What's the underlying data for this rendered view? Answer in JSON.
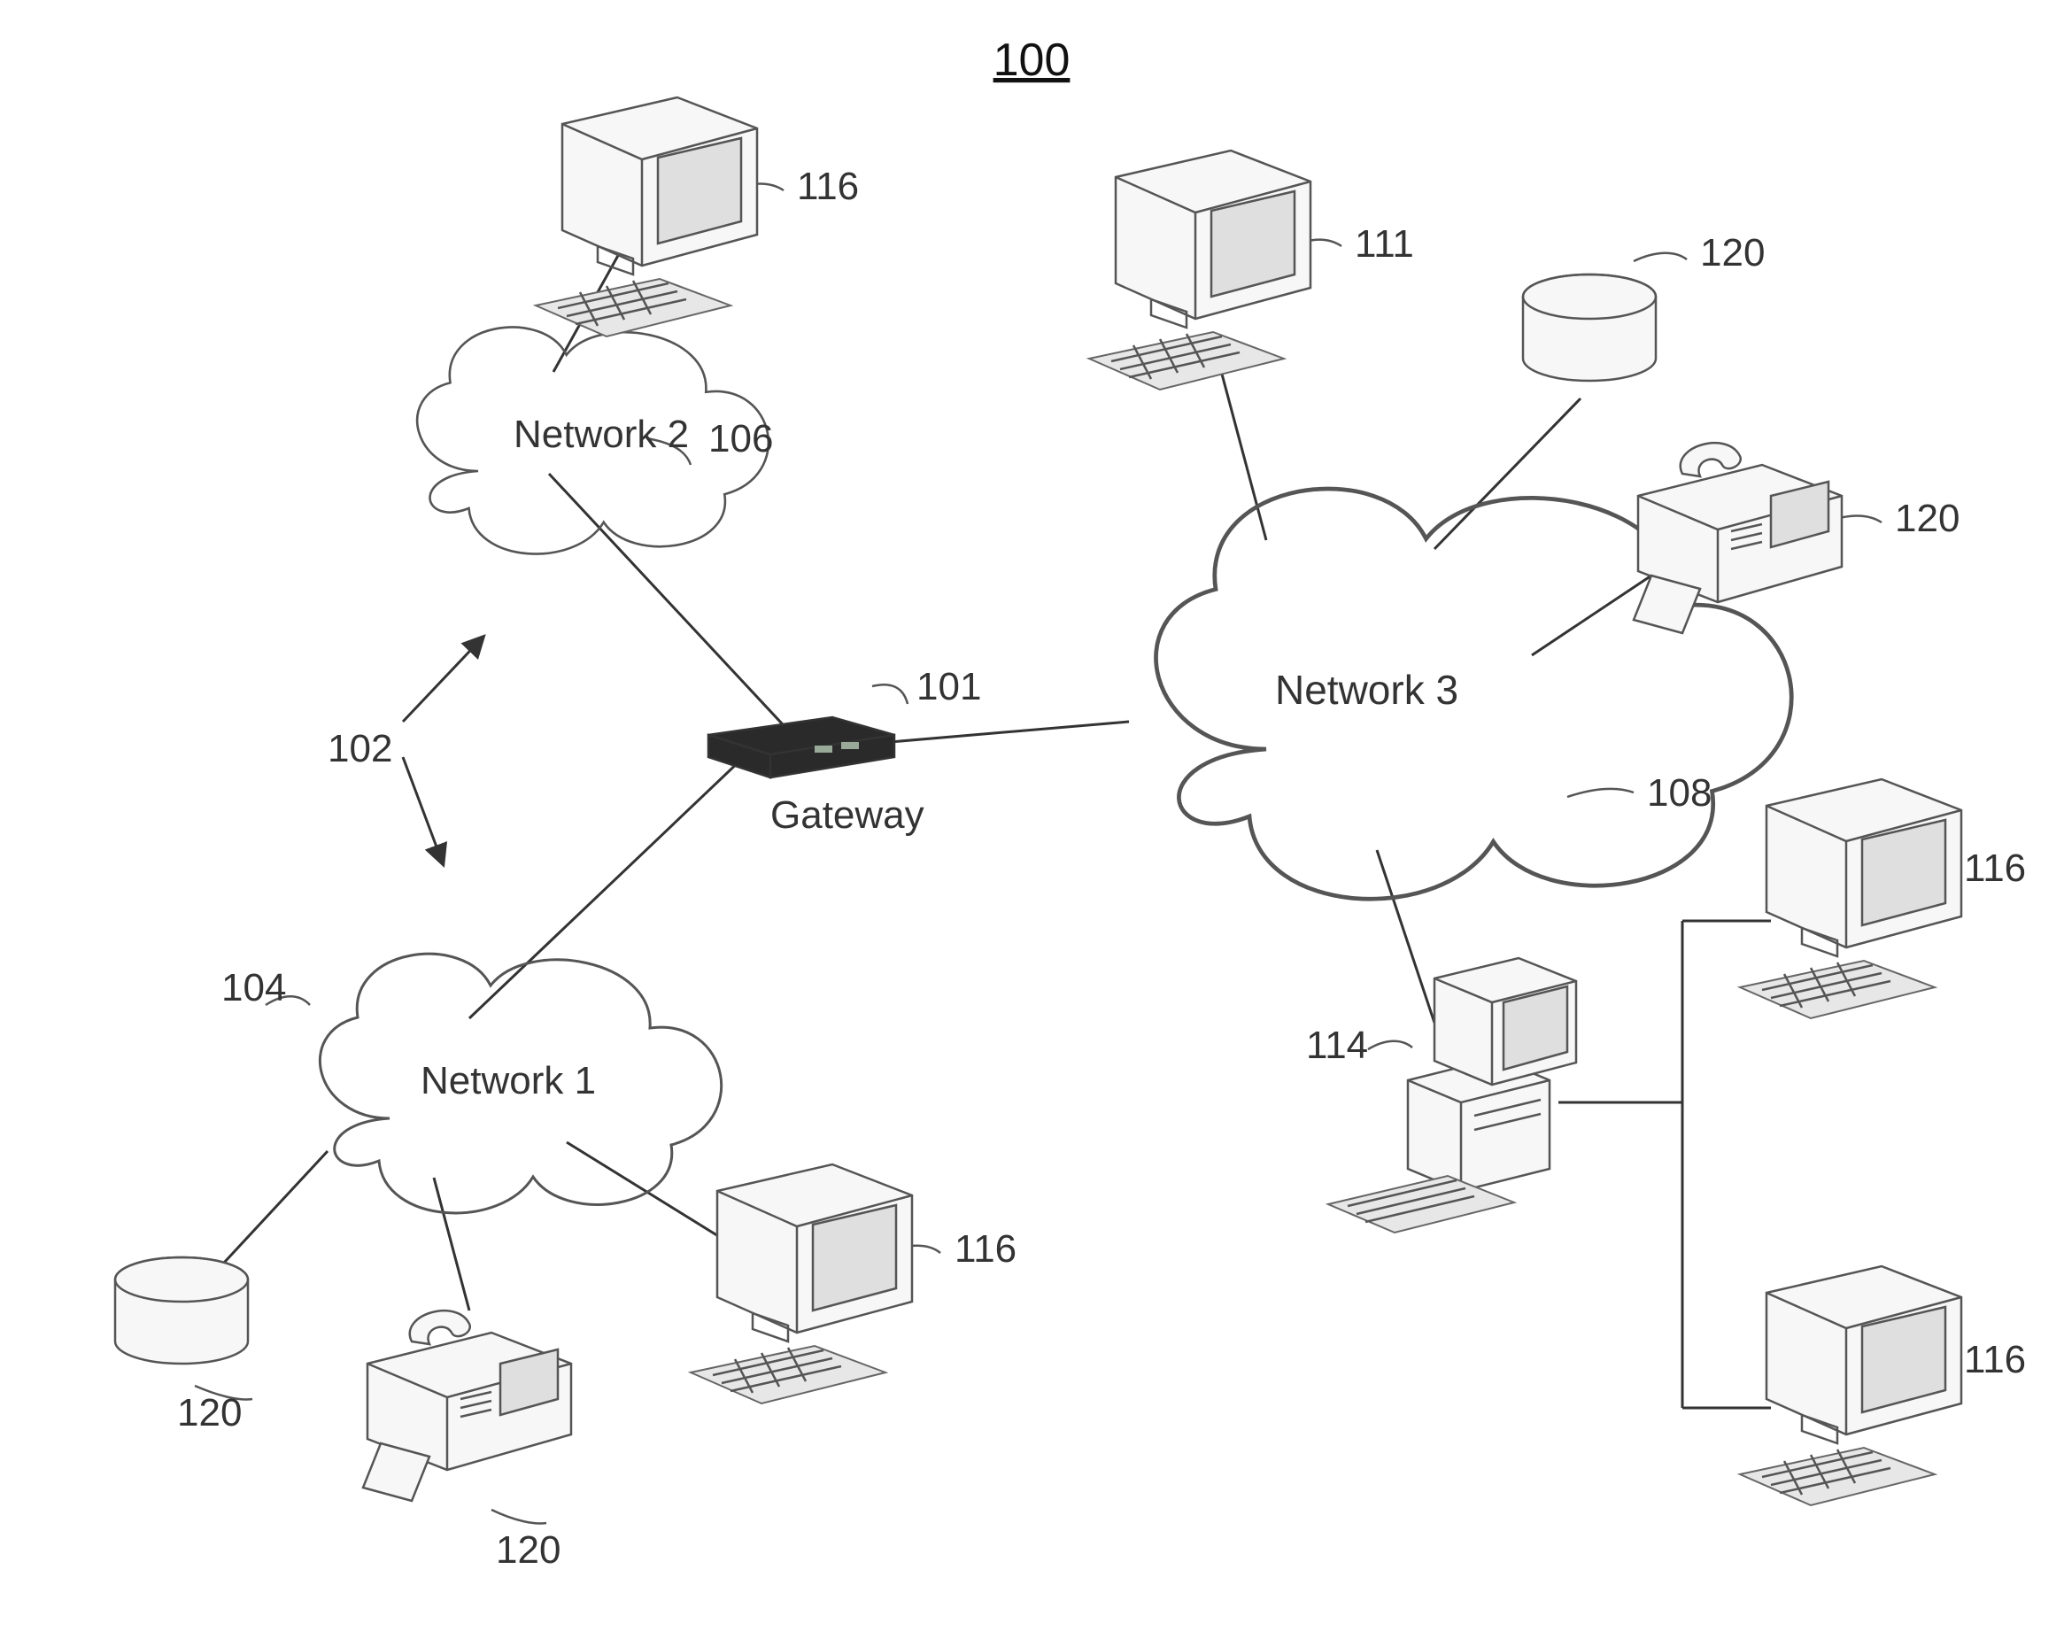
{
  "title": "100",
  "clouds": {
    "n1": {
      "label": "Network 1",
      "ref": "104"
    },
    "n2": {
      "label": "Network 2",
      "ref": "106"
    },
    "n3": {
      "label": "Network 3",
      "ref": "108"
    }
  },
  "gateway": {
    "label": "Gateway",
    "ref": "101"
  },
  "arrows": {
    "ref": "102"
  },
  "nodes": {
    "topPC_n2": {
      "ref": "116"
    },
    "topPC_n3": {
      "ref": "111"
    },
    "disk_n3": {
      "ref": "120"
    },
    "fax_n3": {
      "ref": "120"
    },
    "server": {
      "ref": "114"
    },
    "serverPC1": {
      "ref": "116"
    },
    "serverPC2": {
      "ref": "116"
    },
    "pc_n1": {
      "ref": "116"
    },
    "disk_n1": {
      "ref": "120"
    },
    "fax_n1": {
      "ref": "120"
    }
  }
}
